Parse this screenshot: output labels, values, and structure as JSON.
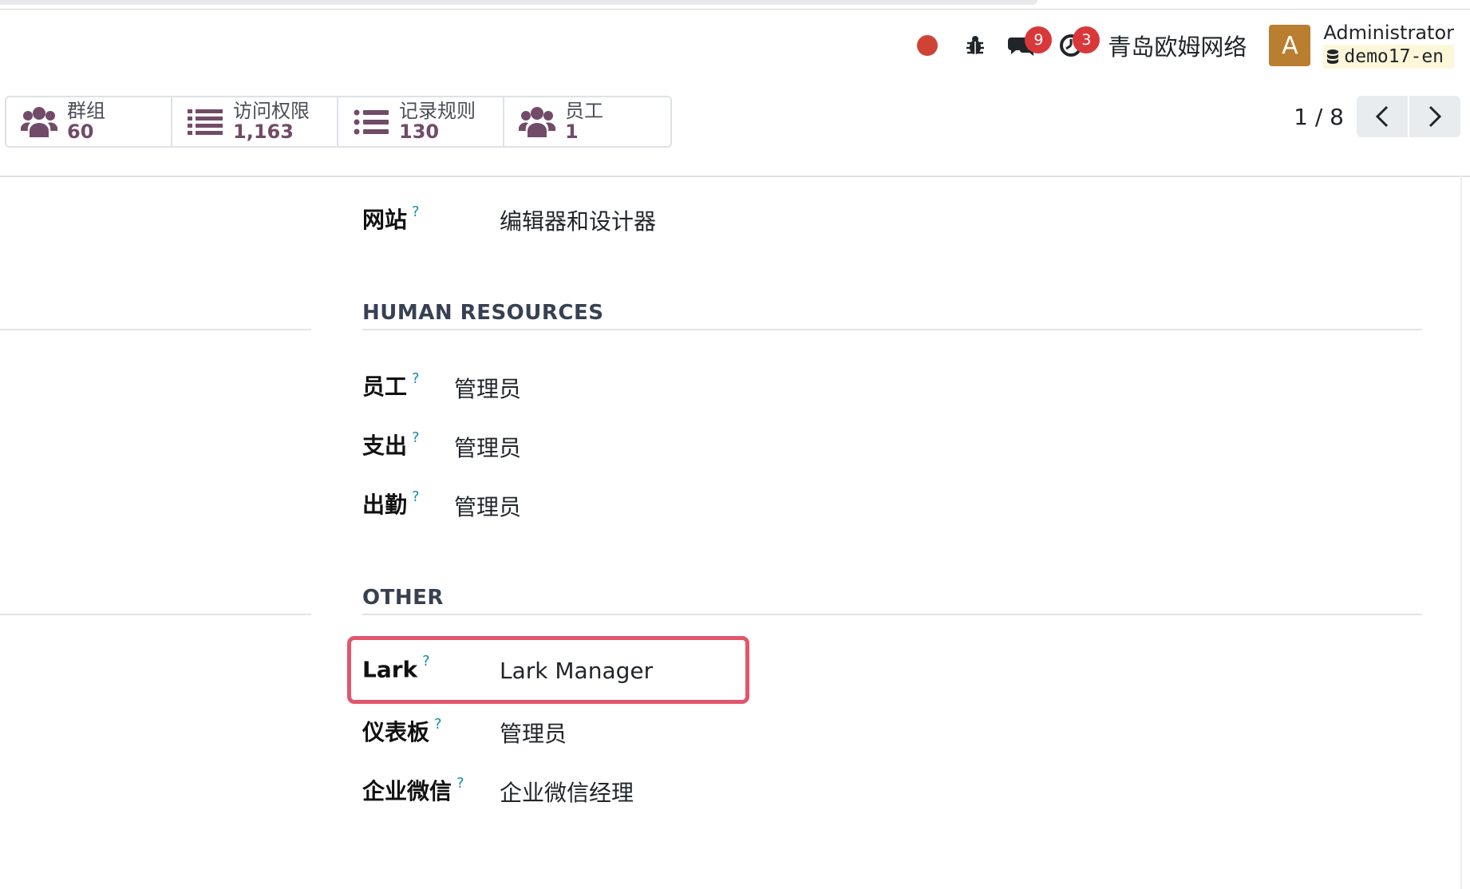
{
  "systray": {
    "messages_count": "9",
    "activities_count": "3",
    "company": "青岛欧姆网络",
    "avatar_letter": "A",
    "user_name": "Administrator",
    "database": "demo17-en"
  },
  "smart_buttons": [
    {
      "label": "群组",
      "value": "60",
      "icon": "users-icon"
    },
    {
      "label": "访问权限",
      "value": "1,163",
      "icon": "list-icon"
    },
    {
      "label": "记录规则",
      "value": "130",
      "icon": "list-icon"
    },
    {
      "label": "员工",
      "value": "1",
      "icon": "users-icon"
    }
  ],
  "pager": {
    "value": "1 / 8"
  },
  "form": {
    "website": {
      "label": "网站",
      "help": "?",
      "value": "编辑器和设计器"
    },
    "hr_section": "HUMAN RESOURCES",
    "hr_fields": [
      {
        "label": "员工",
        "help": "?",
        "value": "管理员"
      },
      {
        "label": "支出",
        "help": "?",
        "value": "管理员"
      },
      {
        "label": "出勤",
        "help": "?",
        "value": "管理员"
      }
    ],
    "other_section": "OTHER",
    "other_fields": [
      {
        "label": "Lark",
        "help": "?",
        "value": "Lark Manager"
      },
      {
        "label": "仪表板",
        "help": "?",
        "value": "管理员"
      },
      {
        "label": "企业微信",
        "help": "?",
        "value": "企业微信经理"
      }
    ]
  },
  "colors": {
    "brand": "#714b67",
    "badge": "#d9383a",
    "avatar": "#b97e2f",
    "highlight": "#e2566b",
    "help": "#0f8fa0"
  }
}
